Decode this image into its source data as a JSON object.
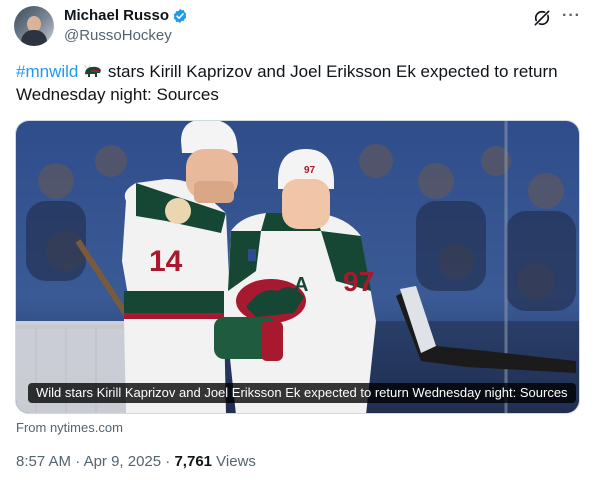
{
  "author": {
    "name": "Michael Russo",
    "handle": "@RussoHockey",
    "verified": true
  },
  "header_icons": [
    "grok-icon",
    "more-icon"
  ],
  "more_label": "···",
  "tweet": {
    "hashtag": "#mnwild",
    "emoji": "bison-emoji",
    "text": " stars Kirill Kaprizov and Joel Eriksson Ek expected to return Wednesday night: Sources"
  },
  "card": {
    "caption": "Wild stars Kirill Kaprizov and Joel Eriksson Ek expected to return Wednesday night: Sources",
    "source": "From nytimes.com",
    "jersey_numbers": [
      "14",
      "97"
    ],
    "captain_mark": "A"
  },
  "meta": {
    "time": "8:57 AM",
    "sep1": " · ",
    "date": "Apr 9, 2025",
    "sep2": " · ",
    "views_count": "7,761",
    "views_label": " Views"
  },
  "colors": {
    "link": "#1d9bf0",
    "secondary_text": "#536471",
    "wild_green": "#154734",
    "wild_red": "#a6192e"
  }
}
